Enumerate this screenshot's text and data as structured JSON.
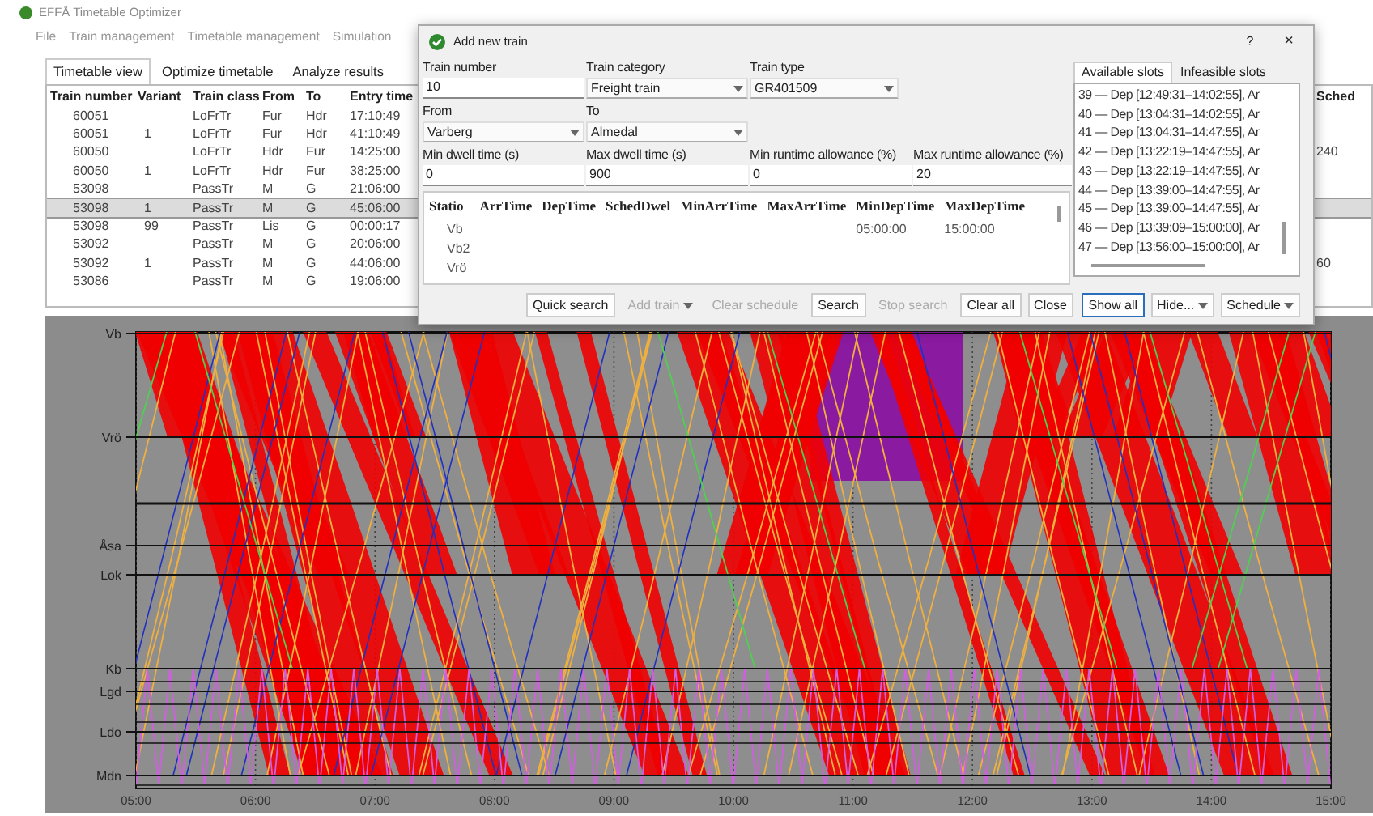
{
  "app": {
    "title": "EFFÅ Timetable Optimizer",
    "menu": [
      "File",
      "Train management",
      "Timetable management",
      "Simulation"
    ]
  },
  "tabs": [
    {
      "label": "Timetable view",
      "selected": true
    },
    {
      "label": "Optimize timetable",
      "selected": false
    },
    {
      "label": "Analyze results",
      "selected": false
    }
  ],
  "train_table": {
    "columns": [
      "Train number",
      "Variant",
      "Train class",
      "From",
      "To",
      "Entry time",
      "Sched"
    ],
    "rows": [
      {
        "train_number": "60051",
        "train_class": "LoFrTr",
        "from": "Fur",
        "to": "Hdr",
        "entry_time": "17:10:49",
        "selected": false
      },
      {
        "train_number": "60051",
        "variant": "1",
        "train_class": "LoFrTr",
        "from": "Fur",
        "to": "Hdr",
        "entry_time": "41:10:49",
        "selected": false
      },
      {
        "train_number": "60050",
        "train_class": "LoFrTr",
        "from": "Hdr",
        "to": "Fur",
        "entry_time": "14:25:00",
        "sched": "240",
        "selected": false
      },
      {
        "train_number": "60050",
        "variant": "1",
        "train_class": "LoFrTr",
        "from": "Hdr",
        "to": "Fur",
        "entry_time": "38:25:00",
        "selected": false
      },
      {
        "train_number": "53098",
        "train_class": "PassTr",
        "from": "M",
        "to": "G",
        "entry_time": "21:06:00",
        "selected": false
      },
      {
        "train_number": "53098",
        "variant": "1",
        "train_class": "PassTr",
        "from": "M",
        "to": "G",
        "entry_time": "45:06:00",
        "selected": true
      },
      {
        "train_number": "53098",
        "variant": "99",
        "train_class": "PassTr",
        "from": "Lis",
        "to": "G",
        "entry_time": "00:00:17",
        "selected": false
      },
      {
        "train_number": "53092",
        "train_class": "PassTr",
        "from": "M",
        "to": "G",
        "entry_time": "20:06:00",
        "selected": false
      },
      {
        "train_number": "53092",
        "variant": "1",
        "train_class": "PassTr",
        "from": "M",
        "to": "G",
        "entry_time": "44:06:00",
        "sched": "60",
        "selected": false
      },
      {
        "train_number": "53086",
        "train_class": "PassTr",
        "from": "M",
        "to": "G",
        "entry_time": "19:06:00",
        "selected": false
      }
    ]
  },
  "graph": {
    "stations": [
      "Vb",
      "Vrö",
      "Åsa",
      "Lok",
      "Kb",
      "Lgd",
      "Ldo",
      "Mdn"
    ],
    "times": [
      "05:00",
      "06:00",
      "07:00",
      "08:00",
      "09:00",
      "10:00",
      "11:00",
      "12:00",
      "13:00",
      "14:00",
      "15:00"
    ]
  },
  "dialog": {
    "title": "Add new train",
    "help": "?",
    "close": "×",
    "fields": [
      {
        "label": "Train number",
        "kind": "text",
        "value": "10"
      },
      {
        "label": "Train category",
        "kind": "select",
        "value": "Freight train"
      },
      {
        "label": "Train type",
        "kind": "select",
        "value": "GR401509"
      },
      {
        "label": "From",
        "kind": "select",
        "value": "Varberg"
      },
      {
        "label": "To",
        "kind": "select",
        "value": "Almedal"
      },
      {
        "label": "Min dwell time (s)",
        "kind": "text",
        "value": "0"
      },
      {
        "label": "Max dwell time (s)",
        "kind": "text",
        "value": "900"
      },
      {
        "label": "Min runtime allowance (%)",
        "kind": "text",
        "value": "0"
      },
      {
        "label": "Max runtime allowance (%)",
        "kind": "text",
        "value": "20"
      }
    ],
    "schedule": {
      "columns": [
        "Statio",
        "ArrTime",
        "DepTime",
        "SchedDwel",
        "MinArrTime",
        "MaxArrTime",
        "MinDepTime",
        "MaxDepTime"
      ],
      "rows": [
        {
          "station": "Vb",
          "min_dep_time": "05:00:00",
          "max_dep_time": "15:00:00"
        },
        {
          "station": "Vb2"
        },
        {
          "station": "Vrö"
        }
      ]
    },
    "buttons": [
      {
        "label": "Quick search",
        "disabled": false,
        "dropdown": false
      },
      {
        "label": "Add train",
        "disabled": true,
        "dropdown": true
      },
      {
        "label": "Clear schedule",
        "disabled": true,
        "dropdown": false
      },
      {
        "label": "Search",
        "disabled": false,
        "dropdown": false
      },
      {
        "label": "Stop search",
        "disabled": true,
        "dropdown": false
      },
      {
        "label": "Clear all",
        "disabled": false,
        "dropdown": false
      },
      {
        "label": "Close",
        "disabled": false,
        "dropdown": false
      }
    ],
    "slot_tabs": [
      {
        "label": "Available slots",
        "selected": true
      },
      {
        "label": "Infeasible slots",
        "selected": false
      }
    ],
    "slots": [
      "39 — Dep [12:49:31–14:02:55], Ar",
      "40 — Dep [13:04:31–14:02:55], Ar",
      "41 — Dep [13:04:31–14:47:55], Ar",
      "42 — Dep [13:22:19–14:47:55], Ar",
      "43 — Dep [13:22:19–14:47:55], Ar",
      "44 — Dep [13:39:00–14:47:55], Ar",
      "45 — Dep [13:39:00–14:47:55], Ar",
      "46 — Dep [13:39:09–15:00:00], Ar",
      "47 — Dep [13:56:00–15:00:00], Ar"
    ],
    "slot_buttons": [
      {
        "label": "Show all",
        "focused": true,
        "dropdown": false
      },
      {
        "label": "Hide...",
        "focused": false,
        "dropdown": true
      },
      {
        "label": "Schedule",
        "focused": false,
        "dropdown": true
      }
    ]
  }
}
